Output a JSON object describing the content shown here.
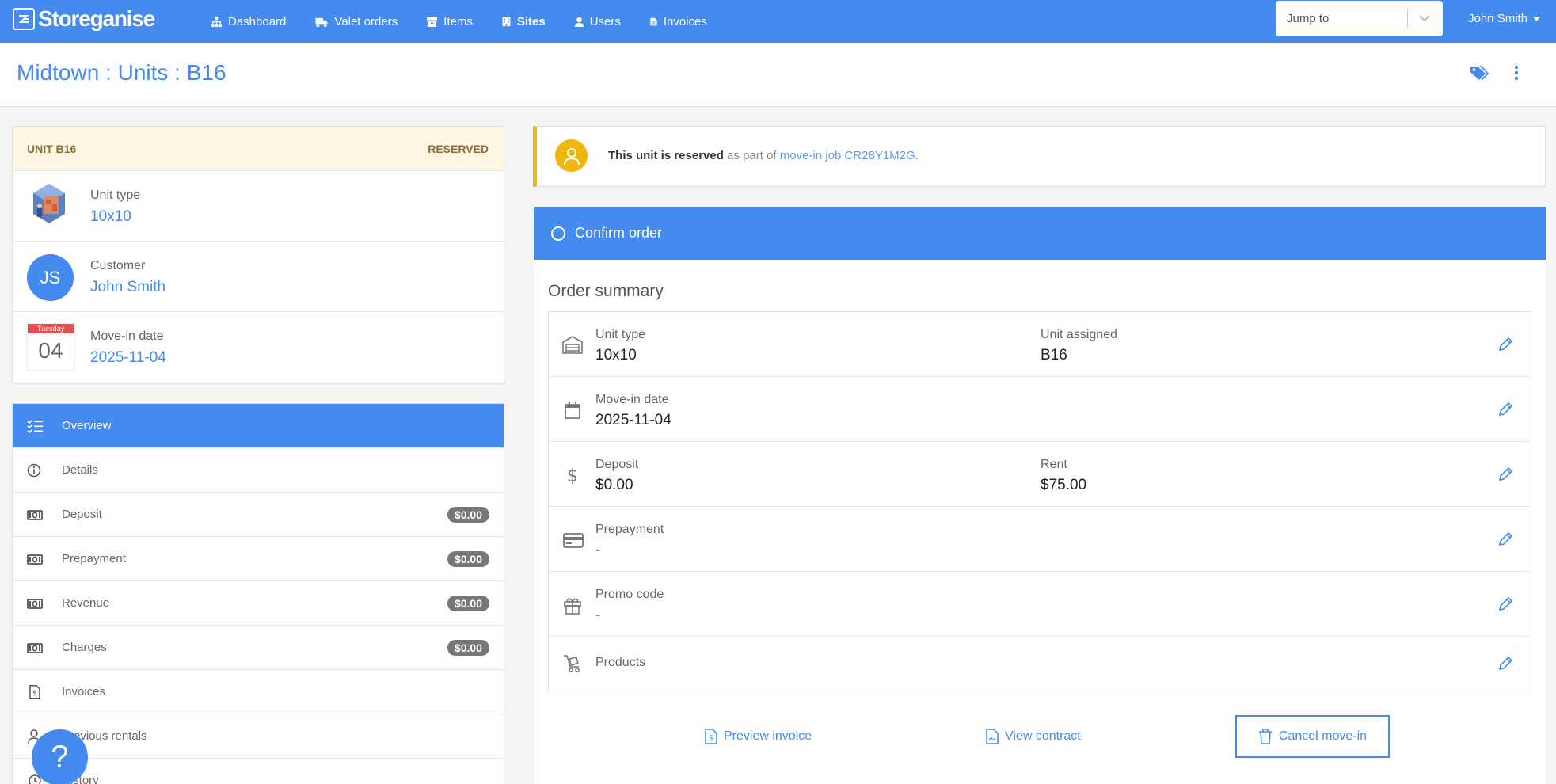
{
  "app": {
    "brand": "Storeganise"
  },
  "nav": {
    "items": [
      {
        "label": "Dashboard",
        "icon": "sitemap-icon"
      },
      {
        "label": "Valet orders",
        "icon": "truck-icon"
      },
      {
        "label": "Items",
        "icon": "archive-icon"
      },
      {
        "label": "Sites",
        "icon": "building-icon"
      },
      {
        "label": "Users",
        "icon": "user-icon"
      },
      {
        "label": "Invoices",
        "icon": "file-icon"
      }
    ],
    "jump_placeholder": "Jump to",
    "user": "John Smith"
  },
  "header": {
    "title": "Midtown : Units : B16"
  },
  "unit_card": {
    "heading": "UNIT B16",
    "status": "RESERVED",
    "unit_type_label": "Unit type",
    "unit_type_value": "10x10",
    "customer_label": "Customer",
    "customer_initials": "JS",
    "customer_value": "John Smith",
    "movein_label": "Move-in date",
    "movein_weekday": "Tuesday",
    "movein_day": "04",
    "movein_value": "2025-11-04"
  },
  "side_menu": [
    {
      "label": "Overview",
      "icon": "checklist-icon",
      "active": true
    },
    {
      "label": "Details",
      "icon": "info-icon"
    },
    {
      "label": "Deposit",
      "icon": "money-icon",
      "badge": "$0.00"
    },
    {
      "label": "Prepayment",
      "icon": "money-icon",
      "badge": "$0.00"
    },
    {
      "label": "Revenue",
      "icon": "money-icon",
      "badge": "$0.00"
    },
    {
      "label": "Charges",
      "icon": "money-icon",
      "badge": "$0.00"
    },
    {
      "label": "Invoices",
      "icon": "invoice-icon"
    },
    {
      "label": "Previous rentals",
      "icon": "user-icon"
    },
    {
      "label": "History",
      "icon": "history-icon"
    }
  ],
  "alert": {
    "bold": "This unit is reserved",
    "text": " as part of ",
    "link": "move-in job CR28Y1M2G",
    "end": "."
  },
  "confirm": {
    "label": "Confirm order"
  },
  "order_summary": {
    "title": "Order summary",
    "rows": [
      {
        "icon": "garage-icon",
        "label": "Unit type",
        "value": "10x10",
        "label2": "Unit assigned",
        "value2": "B16"
      },
      {
        "icon": "calendar-icon",
        "label": "Move-in date",
        "value": "2025-11-04"
      },
      {
        "icon": "dollar-icon",
        "label": "Deposit",
        "value": "$0.00",
        "label2": "Rent",
        "value2": "$75.00"
      },
      {
        "icon": "credit-card-icon",
        "label": "Prepayment",
        "value": "-"
      },
      {
        "icon": "gift-icon",
        "label": "Promo code",
        "value": "-"
      },
      {
        "icon": "cart-icon",
        "label": "Products"
      }
    ]
  },
  "actions": {
    "preview_invoice": "Preview invoice",
    "view_contract": "View contract",
    "cancel_movein": "Cancel move-in"
  },
  "help": {
    "label": "?"
  },
  "colors": {
    "primary": "#448aef",
    "warning": "#f0b70a",
    "reserved_bg": "#fdf6e2"
  }
}
